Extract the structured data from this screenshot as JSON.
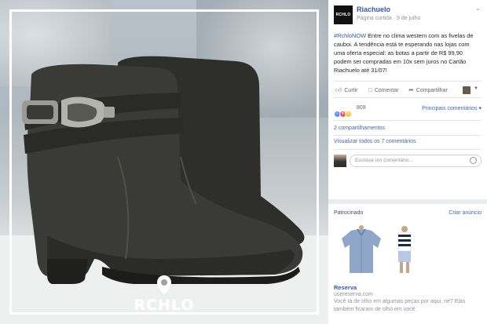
{
  "photo": {
    "logo_text": "RCHLO"
  },
  "post": {
    "page_name": "Riachuelo",
    "avatar_text": "RCHLO",
    "meta_type": "Página curtida",
    "meta_date": "9 de julho",
    "hashtag": "#RchloNOW",
    "body": " Entre no clima western com as fivelas de cauboi. A tendência está te esperando nas lojas com uma oferta especial: as botas a partir de R$ 99,90 podem ser compradas em 10x sem juros no Cartão Riachuelo até 31/07!"
  },
  "actions": {
    "like": "Curtir",
    "comment": "Comentar",
    "share": "Compartilhar"
  },
  "reactions": {
    "count": "809",
    "top_comments": "Principais comentários"
  },
  "stats": {
    "shares": "2 compartilhamentos",
    "view_comments": "Visualizar todos os 7 comentários"
  },
  "comment": {
    "placeholder": "Escreva um comentário..."
  },
  "ad": {
    "sponsored": "Patrocinado",
    "create_ad": "Criar anúncio",
    "title": "Reserva",
    "url": "usereserva.com",
    "description": "Você tá de olho em algumas peças por aqui, né? Elas também ficaram de olho em você."
  },
  "colors": {
    "link": "#365899",
    "accent": "#4267b2",
    "muted": "#90949c"
  }
}
